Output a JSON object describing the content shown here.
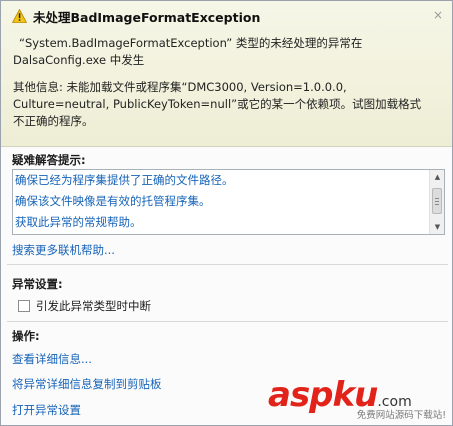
{
  "dialog": {
    "title": "未处理BadImageFormatException",
    "close_glyph": "×"
  },
  "message": {
    "line1": "“System.BadImageFormatException” 类型的未经处理的异常在",
    "line2": "DalsaConfig.exe 中发生",
    "line3": "其他信息: 未能加载文件或程序集“DMC3000, Version=1.0.0.0,",
    "line4": "Culture=neutral, PublicKeyToken=null”或它的某一个依赖项。试图加载格式",
    "line5": "不正确的程序。"
  },
  "troubleshooting": {
    "title": "疑难解答提示:",
    "tips": [
      "确保已经为程序集提供了正确的文件路径。",
      "确保该文件映像是有效的托管程序集。",
      "获取此异常的常规帮助。"
    ],
    "search_link": "搜索更多联机帮助..."
  },
  "exception_settings": {
    "title": "异常设置:",
    "break_label": "引发此异常类型时中断",
    "break_checked": false
  },
  "actions": {
    "title": "操作:",
    "view_details": "查看详细信息...",
    "copy_details": "将异常详细信息复制到剪贴板",
    "open_settings": "打开异常设置"
  },
  "watermark": {
    "brand_asp": "asp",
    "brand_ku": "ku",
    "brand_com": ".com",
    "subtitle": "免费网站源码下载站!"
  },
  "colors": {
    "header_bg": "#f1f1de",
    "link": "#1663b8",
    "warning": "#f3c417",
    "brand_red": "#e2231a"
  }
}
